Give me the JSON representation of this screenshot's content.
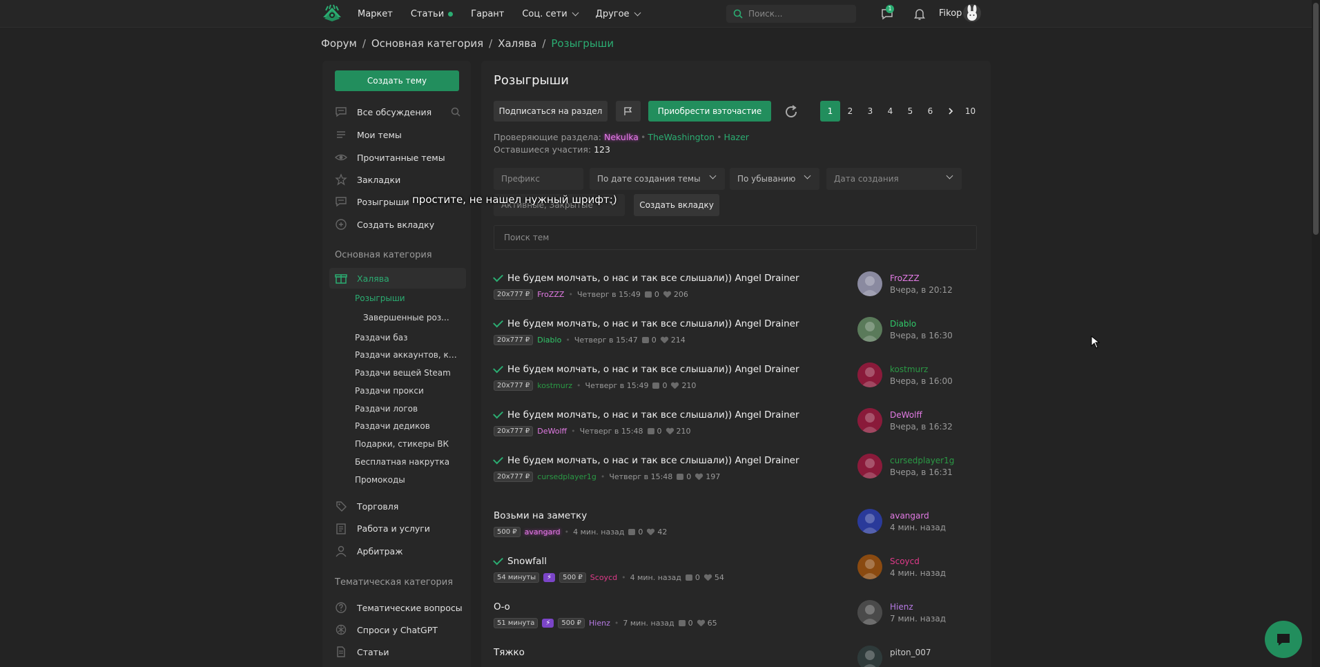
{
  "topnav": {
    "items": [
      {
        "label": "Маркет",
        "has_dot": false,
        "has_chevron": false
      },
      {
        "label": "Статьи",
        "has_dot": true,
        "has_chevron": false
      },
      {
        "label": "Гарант",
        "has_dot": false,
        "has_chevron": false
      },
      {
        "label": "Соц. сети",
        "has_dot": false,
        "has_chevron": true
      },
      {
        "label": "Другое",
        "has_dot": false,
        "has_chevron": true
      }
    ],
    "search_placeholder": "Поиск...",
    "notification_count": "1",
    "username": "Fikop"
  },
  "breadcrumb": {
    "items": [
      "Форум",
      "Основная категория",
      "Халява"
    ],
    "current": "Розыгрыши"
  },
  "sidebar": {
    "create_label": "Создать тему",
    "items": [
      {
        "label": "Все обсуждения",
        "icon": "chat-icon"
      },
      {
        "label": "Мои темы",
        "icon": "list-icon"
      },
      {
        "label": "Прочитанные темы",
        "icon": "eye-icon"
      },
      {
        "label": "Закладки",
        "icon": "star-icon"
      },
      {
        "label": "Розыгрыши",
        "icon": "chat-icon"
      },
      {
        "label": "Создать вкладку",
        "icon": "plus-circle-icon"
      }
    ],
    "heading_main": "Основная категория",
    "active_item": "Халява",
    "sub_items": [
      "Розыгрыши",
      "Завершенные роз...",
      "Раздачи баз",
      "Раздачи аккаунтов, клю...",
      "Раздачи вещей Steam",
      "Раздачи прокси",
      "Раздачи логов",
      "Раздачи дедиков",
      "Подарки, стикеры ВК",
      "Бесплатная накрутка",
      "Промокоды"
    ],
    "more_items": [
      {
        "label": "Торговля",
        "icon": "tag-icon"
      },
      {
        "label": "Работа и услуги",
        "icon": "clipboard-icon"
      },
      {
        "label": "Арбитраж",
        "icon": "user-icon"
      }
    ],
    "heading_theme": "Тематическая категория",
    "theme_items": [
      {
        "label": "Тематические вопросы",
        "icon": "question-icon"
      },
      {
        "label": "Спроси у ChatGPT",
        "icon": "openai-icon"
      },
      {
        "label": "Статьи",
        "icon": "document-icon"
      }
    ]
  },
  "main": {
    "title": "Розыгрыши",
    "subscribe_label": "Подписаться на раздел",
    "participate_label": "Приобрести вэточастие",
    "pages": [
      "1",
      "2",
      "3",
      "4",
      "5",
      "6",
      "10"
    ],
    "current_page": "1",
    "moderators_label": "Проверяющие раздела:",
    "moderators": [
      "Nekulka",
      "TheWashington",
      "Hazer"
    ],
    "remaining_label": "Оставшиеся участия:",
    "remaining_value": "123",
    "filters": {
      "prefix_placeholder": "Префикс",
      "sort": "По дате создания темы",
      "order": "По убыванию",
      "date_placeholder": "Дата создания",
      "status": "Активные, Закрытые",
      "create_tab": "Создать вкладку"
    },
    "search_placeholder": "Поиск тем",
    "overlay_note": "простите, не нашел нужный шрифт:)"
  },
  "topics": [
    {
      "title": "Не будем молчать, о нас и так все слышали)) Angel Drainer",
      "checked": true,
      "tags": [
        "20x777 ₽"
      ],
      "author": "FroZZZ",
      "author_color": "#e37be5",
      "time": "Четверг в 15:49",
      "replies": "0",
      "likes": "206",
      "last_user": "FroZZZ",
      "last_color": "#e37be5",
      "last_time": "Вчера, в 20:12",
      "avatar": "#8a8aa0"
    },
    {
      "title": "Не будем молчать, о нас и так все слышали)) Angel Drainer",
      "checked": true,
      "tags": [
        "20x777 ₽"
      ],
      "author": "Diablo",
      "author_color": "#31c96a",
      "time": "Четверг в 15:47",
      "replies": "0",
      "likes": "214",
      "last_user": "Diablo",
      "last_color": "#31c96a",
      "last_time": "Вчера, в 16:30",
      "avatar": "#5a7a5a"
    },
    {
      "title": "Не будем молчать, о нас и так все слышали)) Angel Drainer",
      "checked": true,
      "tags": [
        "20x777 ₽"
      ],
      "author": "kostmurz",
      "author_color": "#2a9a45",
      "time": "Четверг в 15:49",
      "replies": "0",
      "likes": "210",
      "last_user": "kostmurz",
      "last_color": "#2a9a45",
      "last_time": "Вчера, в 16:00",
      "avatar": "#8a1a3a"
    },
    {
      "title": "Не будем молчать, о нас и так все слышали)) Angel Drainer",
      "checked": true,
      "tags": [
        "20x777 ₽"
      ],
      "author": "DeWolff",
      "author_color": "#e37be5",
      "time": "Четверг в 15:48",
      "replies": "0",
      "likes": "210",
      "last_user": "DeWolff",
      "last_color": "#e37be5",
      "last_time": "Вчера, в 16:32",
      "avatar": "#8a1a3a"
    },
    {
      "title": "Не будем молчать, о нас и так все слышали)) Angel Drainer",
      "checked": true,
      "tags": [
        "20x777 ₽"
      ],
      "author": "cursedplayer1g",
      "author_color": "#2a9a45",
      "time": "Четверг в 15:48",
      "replies": "0",
      "likes": "197",
      "last_user": "cursedplayer1g",
      "last_color": "#2a9a45",
      "last_time": "Вчера, в 16:31",
      "avatar": "#8a1a3a"
    },
    {
      "title": "Возьми на заметку",
      "checked": false,
      "tags": [
        "500 ₽"
      ],
      "author": "avangard",
      "author_color": "#e37be5",
      "time": "4 мин. назад",
      "replies": "0",
      "likes": "42",
      "last_user": "avangard",
      "last_color": "#e37be5",
      "last_time": "4 мин. назад",
      "avatar": "#2a3a9a"
    },
    {
      "title": "Snowfall",
      "checked": true,
      "tags": [
        "54 минуты",
        "⚡",
        "500 ₽"
      ],
      "author": "Scoycd",
      "author_color": "#e03a8a",
      "time": "4 мин. назад",
      "replies": "0",
      "likes": "54",
      "last_user": "Scoycd",
      "last_color": "#e03a8a",
      "last_time": "4 мин. назад",
      "avatar": "#8a4a10"
    },
    {
      "title": "О-о",
      "checked": false,
      "tags": [
        "51 минута",
        "⚡",
        "500 ₽"
      ],
      "author": "Hienz",
      "author_color": "#b77be5",
      "time": "7 мин. назад",
      "replies": "0",
      "likes": "65",
      "last_user": "Hienz",
      "last_color": "#b77be5",
      "last_time": "7 мин. назад",
      "avatar": "#4a4a4a"
    },
    {
      "title": "Тяжко",
      "checked": false,
      "tags": [],
      "author": "",
      "author_color": "#cccccc",
      "time": "",
      "replies": "",
      "likes": "",
      "last_user": "piton_007",
      "last_color": "#cccccc",
      "last_time": "",
      "avatar": "#2e3a3a"
    }
  ],
  "colors": {
    "accent": "#2bad72",
    "button": "#228e5d",
    "background": "#232323",
    "panel": "#272727"
  }
}
